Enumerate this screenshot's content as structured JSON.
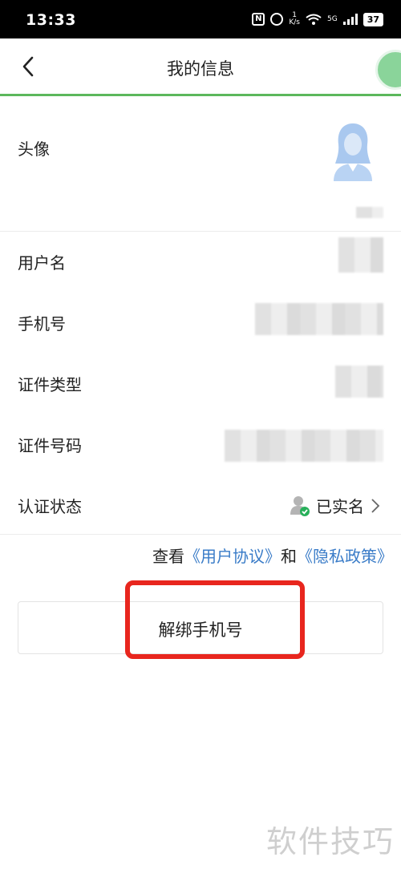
{
  "status_bar": {
    "time": "13:33",
    "speed_value": "1",
    "speed_unit": "K/s",
    "network": "5G",
    "battery": "37"
  },
  "header": {
    "title": "我的信息",
    "back_icon": "chevron-left-icon"
  },
  "profile": {
    "avatar_label": "头像",
    "username_label": "用户名",
    "phone_label": "手机号",
    "id_type_label": "证件类型",
    "id_number_label": "证件号码",
    "verify_label": "认证状态",
    "verify_value": "已实名"
  },
  "agreement": {
    "prefix": "查看",
    "user_agreement": "《用户协议》",
    "and": "和",
    "privacy_policy": "《隐私政策》"
  },
  "actions": {
    "unbind_phone": "解绑手机号"
  },
  "watermark": "软件技巧",
  "colors": {
    "accent_green": "#5cb85c",
    "link_blue": "#3a7cc8",
    "highlight_red": "#e8261e"
  }
}
